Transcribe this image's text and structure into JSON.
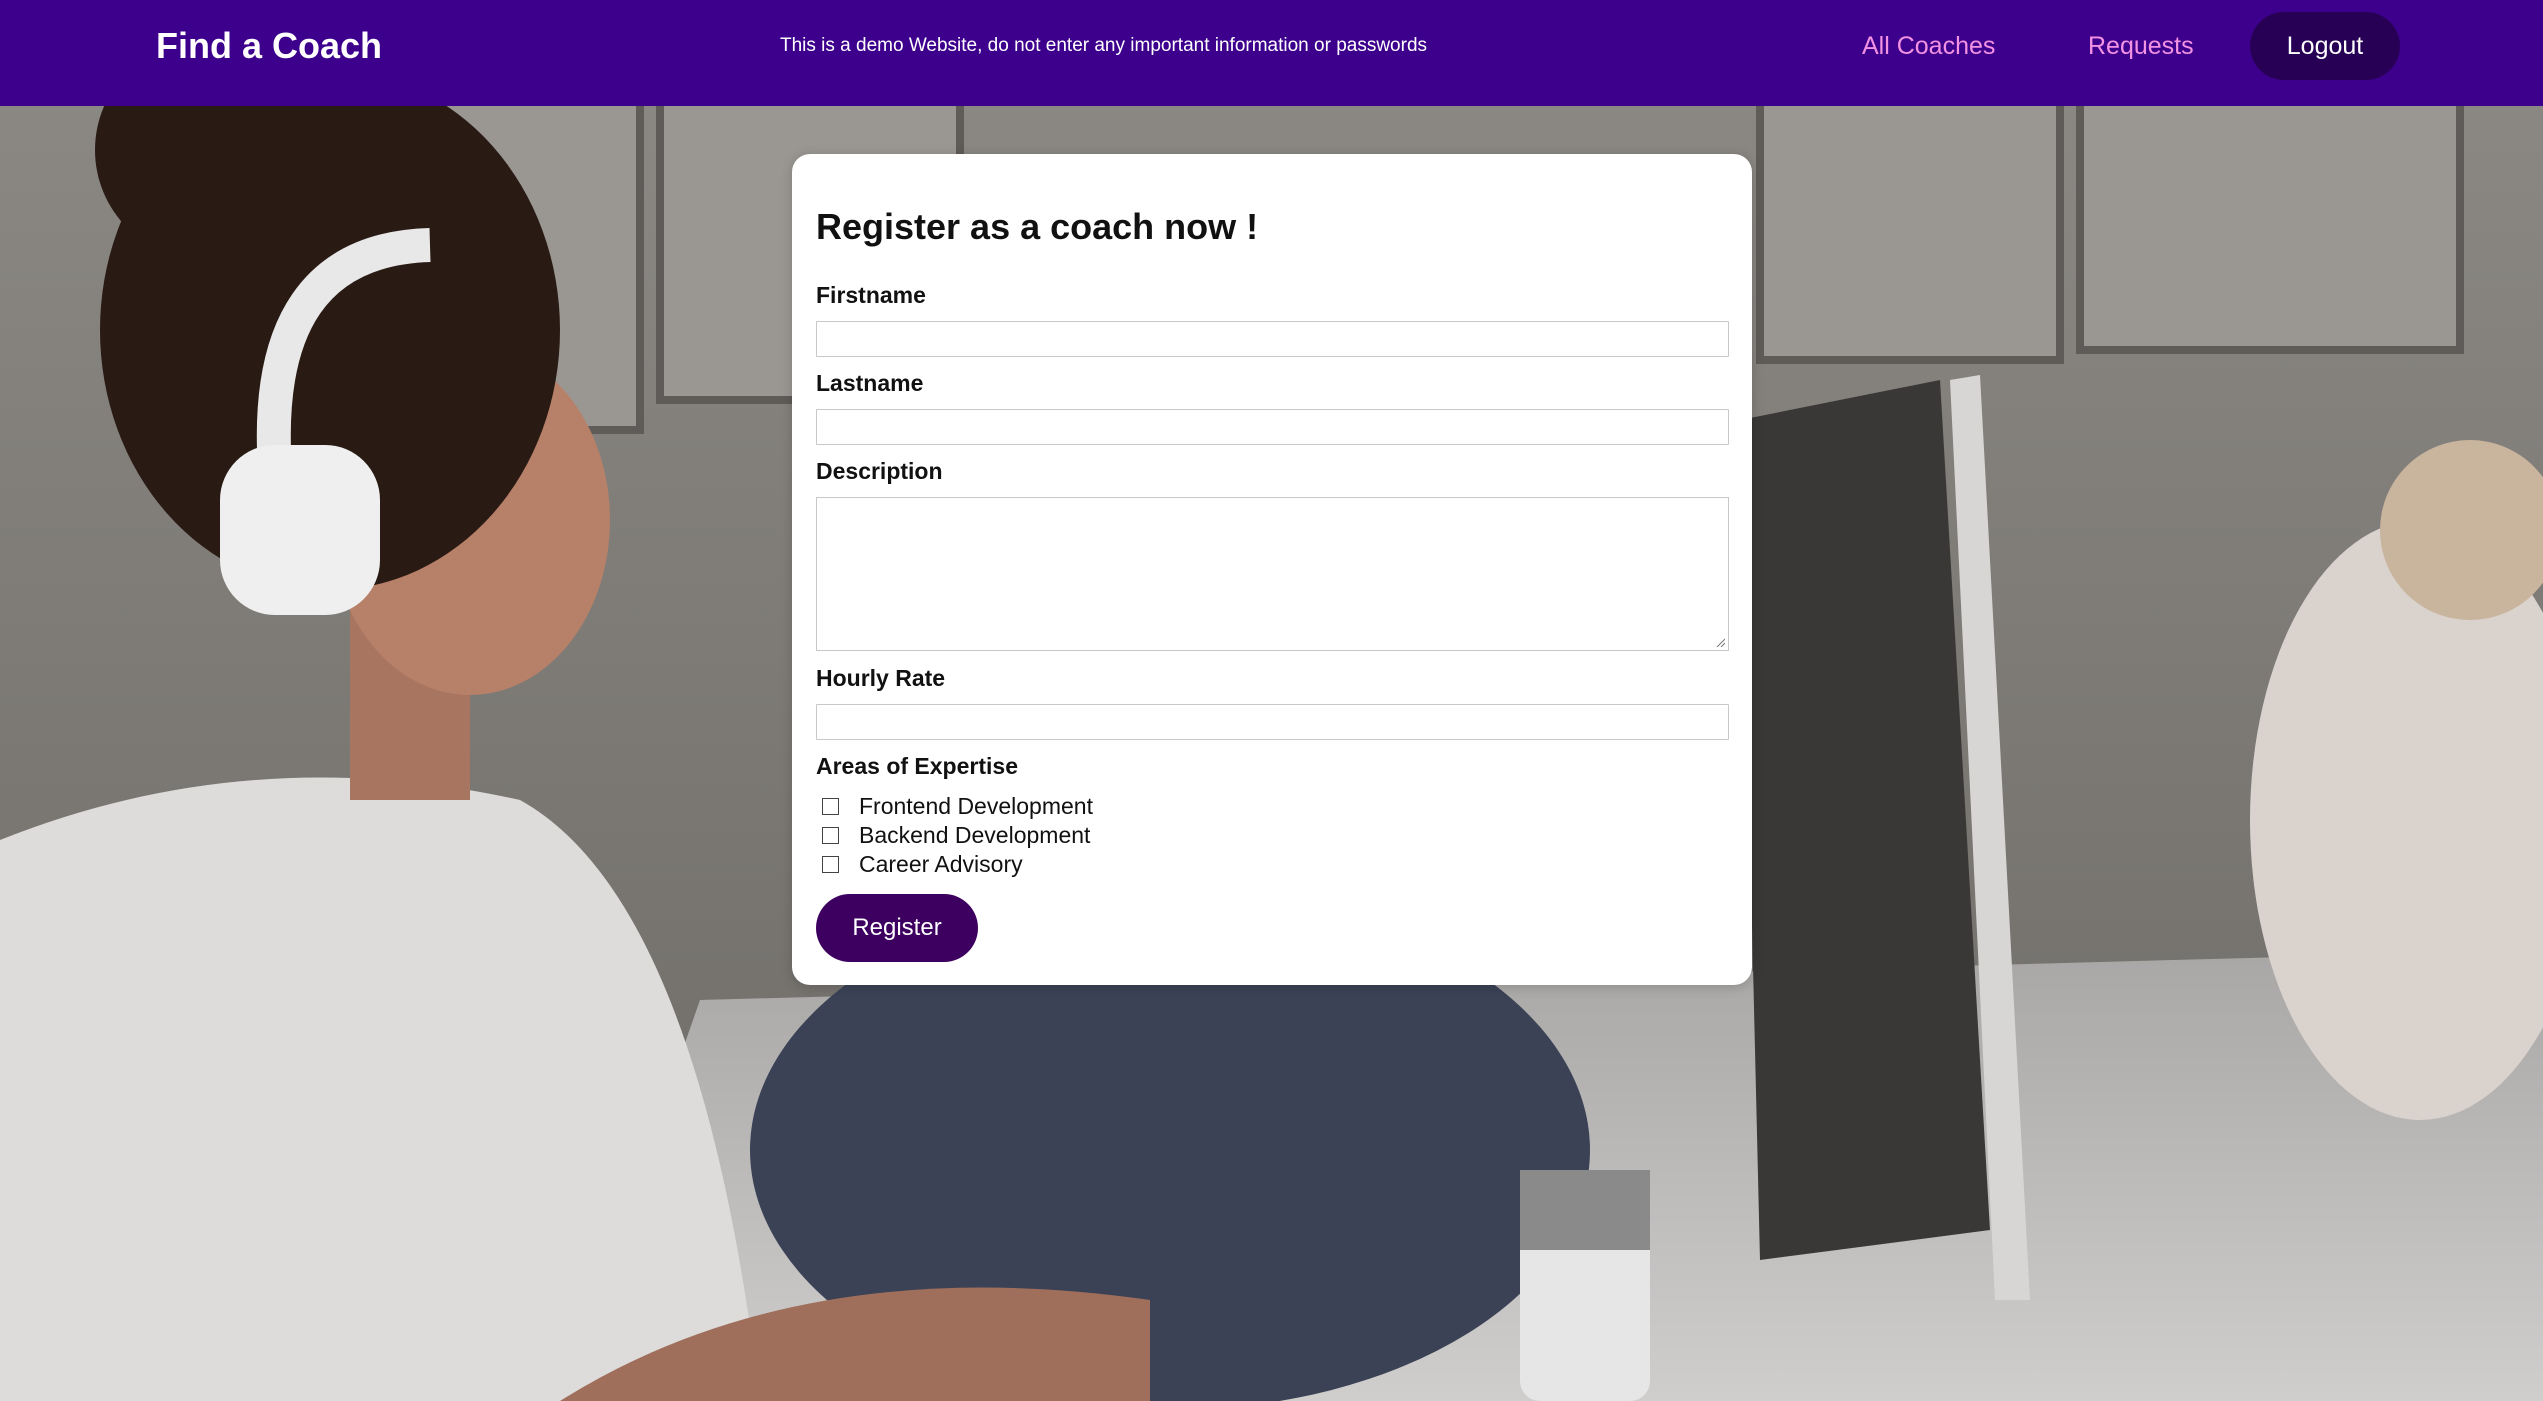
{
  "header": {
    "brand": "Find a Coach",
    "demo_notice": "This is a demo Website, do not enter any important information or passwords",
    "nav": {
      "all_coaches": "All Coaches",
      "requests": "Requests",
      "logout": "Logout"
    }
  },
  "form": {
    "title": "Register as a coach now !",
    "fields": {
      "firstname": {
        "label": "Firstname",
        "value": "",
        "placeholder": ""
      },
      "lastname": {
        "label": "Lastname",
        "value": "",
        "placeholder": ""
      },
      "description": {
        "label": "Description",
        "value": "",
        "placeholder": ""
      },
      "rate": {
        "label": "Hourly Rate",
        "value": "",
        "placeholder": ""
      }
    },
    "expertise": {
      "label": "Areas of Expertise",
      "options": [
        "Frontend Development",
        "Backend Development",
        "Career Advisory"
      ]
    },
    "submit_label": "Register"
  },
  "colors": {
    "header_bg": "#3d008d",
    "nav_link": "#f391e3",
    "logout_bg": "#270056",
    "register_bg": "#3d0060"
  }
}
